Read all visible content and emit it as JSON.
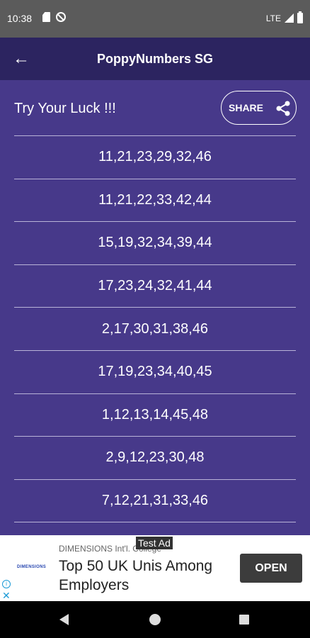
{
  "status_bar": {
    "time": "10:38",
    "network": "LTE"
  },
  "app_bar": {
    "back_icon": "arrow-left-icon",
    "title": "PoppyNumbers SG",
    "color": "#2c2460"
  },
  "header": {
    "title": "Try Your Luck !!!",
    "share_label": "SHARE",
    "share_icon": "share-icon"
  },
  "numbers": [
    "11,21,23,29,32,46",
    "11,21,22,33,42,44",
    "15,19,32,34,39,44",
    "17,23,24,32,41,44",
    "2,17,30,31,38,46",
    "17,19,23,34,40,45",
    "1,12,13,14,45,48",
    "2,9,12,23,30,48",
    "7,12,21,31,33,46"
  ],
  "ad": {
    "tag": "Test Ad",
    "logo_text": "DIMENSIONS",
    "sponsor": "DIMENSIONS Int'l. College",
    "headline": "Top 50 UK Unis Among Employers",
    "cta": "OPEN"
  },
  "theme": {
    "background": "#47398a",
    "divider": "#b9b3d8"
  }
}
